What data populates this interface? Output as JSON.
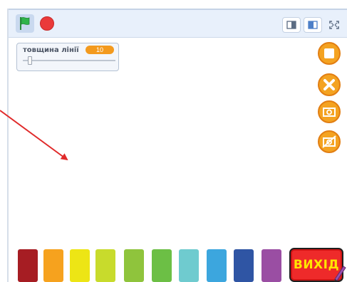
{
  "toolbar": {
    "icons": [
      "green-flag-icon",
      "stop-icon",
      "small-stage-icon",
      "large-stage-icon",
      "fullscreen-icon"
    ],
    "colors": {
      "flag": "#2fb44a",
      "stop": "#ea3a3a",
      "toolbar_bg": "#e8f0fb"
    }
  },
  "monitor": {
    "label": "товщина лінії",
    "value": "10",
    "slider_fraction": 0.08
  },
  "side_buttons": [
    "square-icon",
    "close-icon",
    "camera-icon",
    "camera-off-icon"
  ],
  "palette": {
    "colors": [
      "#a61d23",
      "#f6a21e",
      "#ede515",
      "#c8db2c",
      "#8fc43c",
      "#6cbf45",
      "#6fcbcf",
      "#3ca6de",
      "#2f55a4",
      "#9a4ea3"
    ]
  },
  "exit_button": {
    "label": "ВИХІД",
    "bg": "#ee2a2a",
    "text_color": "#ffe600"
  },
  "annotation": {
    "type": "arrow",
    "color": "#e02a2a"
  }
}
